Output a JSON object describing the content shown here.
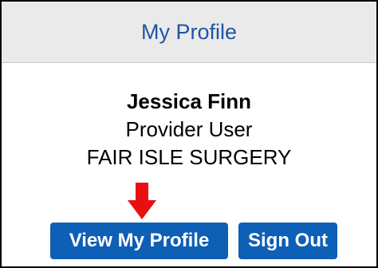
{
  "panel": {
    "title": "My Profile"
  },
  "user": {
    "name": "Jessica Finn",
    "role": "Provider User",
    "organization": "FAIR ISLE SURGERY"
  },
  "actions": {
    "view_profile_label": "View My Profile",
    "sign_out_label": "Sign Out"
  },
  "annotation": {
    "arrow_icon": "red-down-arrow-icon",
    "arrow_color": "#e8100f"
  },
  "colors": {
    "title": "#1f55a6",
    "button": "#0e5fb6",
    "header_bg": "#eaeaea"
  }
}
